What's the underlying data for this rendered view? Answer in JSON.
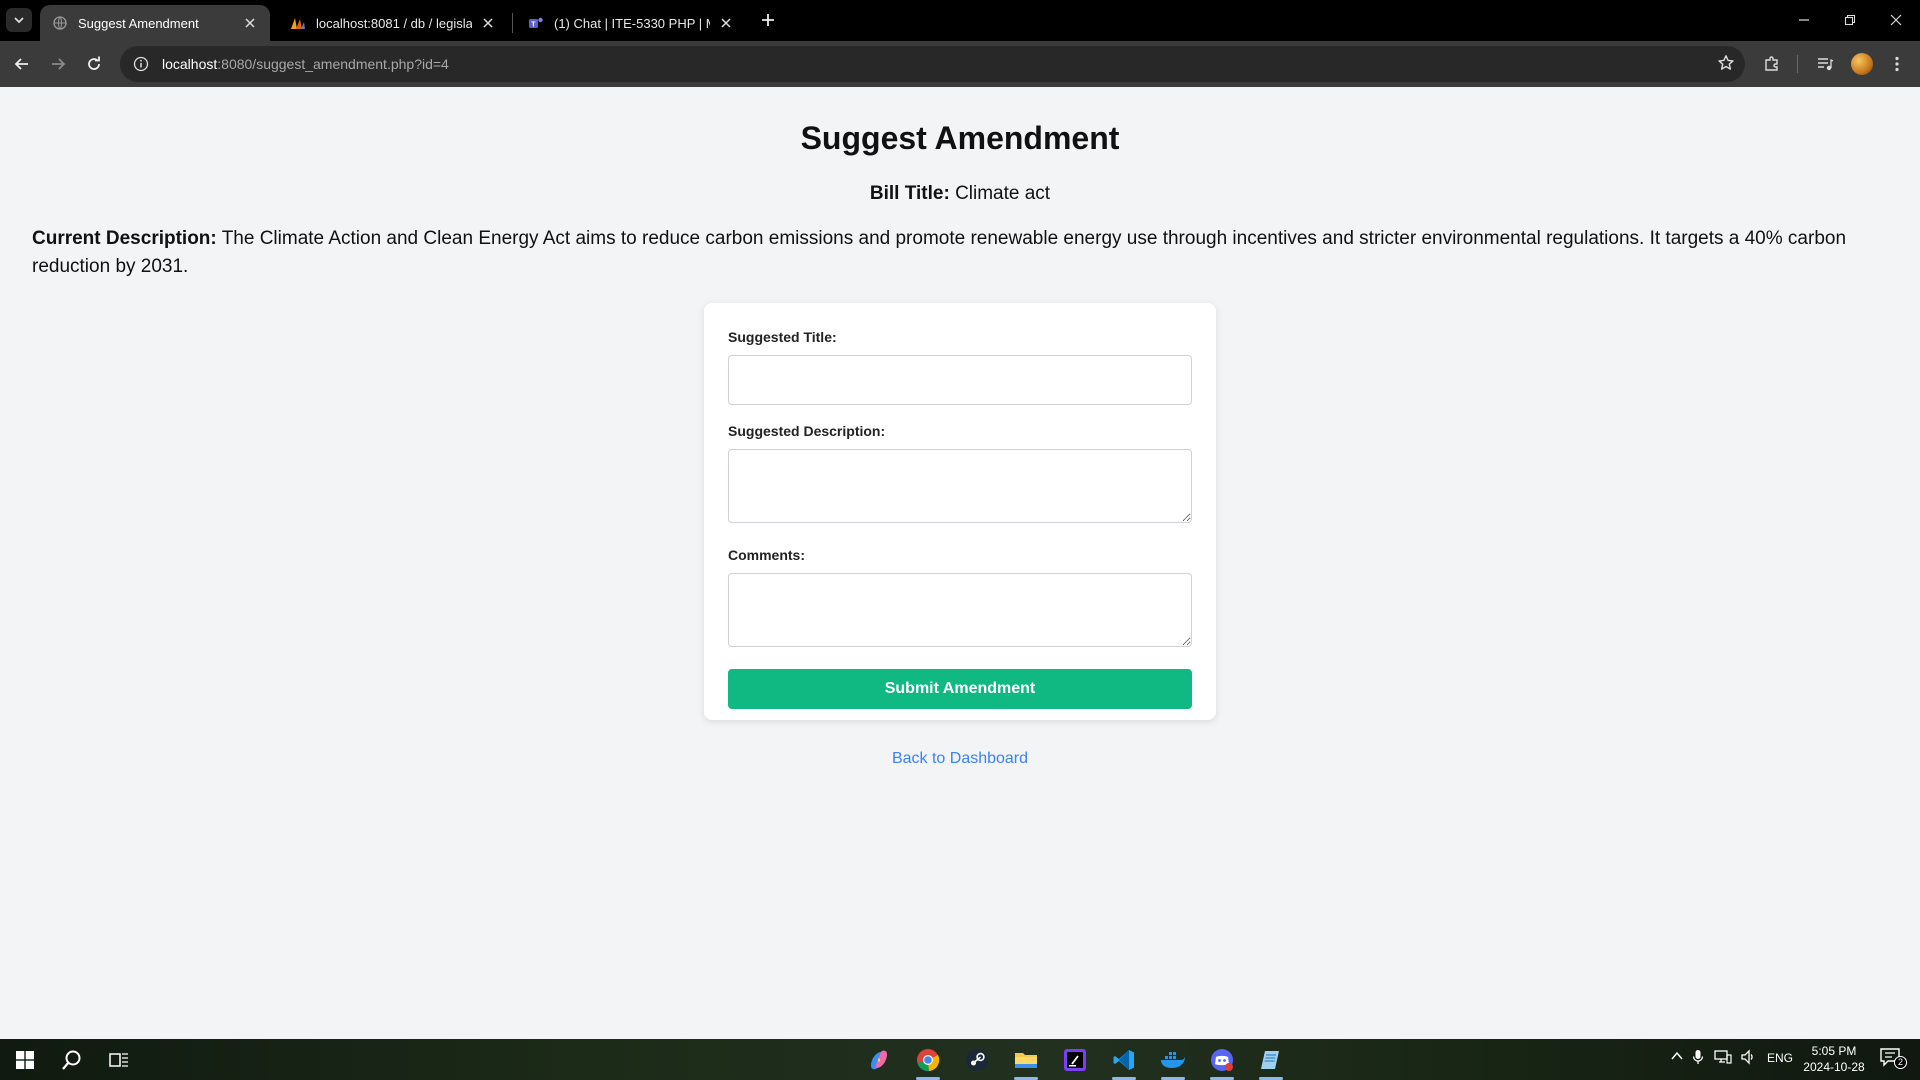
{
  "browser": {
    "tabs": [
      {
        "title": "Suggest Amendment",
        "active": true
      },
      {
        "title": "localhost:8081 / db / legislation",
        "active": false
      },
      {
        "title": "(1) Chat | ITE-5330 PHP | Micro",
        "active": false
      }
    ],
    "url_host": "localhost",
    "url_rest": ":8080/suggest_amendment.php?id=4"
  },
  "page": {
    "title": "Suggest Amendment",
    "bill_title_label": "Bill Title:",
    "bill_title_value": "Climate act",
    "current_description_label": "Current Description:",
    "current_description_value": "The Climate Action and Clean Energy Act aims to reduce carbon emissions and promote renewable energy use through incentives and stricter environmental regulations. It targets a 40% carbon reduction by 2031.",
    "form": {
      "suggested_title_label": "Suggested Title:",
      "suggested_title_value": "",
      "suggested_description_label": "Suggested Description:",
      "suggested_description_value": "",
      "comments_label": "Comments:",
      "comments_value": "",
      "submit_label": "Submit Amendment"
    },
    "back_link": "Back to Dashboard"
  },
  "taskbar": {
    "language": "ENG",
    "time": "5:05 PM",
    "date": "2024-10-28",
    "notification_count": "2"
  },
  "colors": {
    "accent_green": "#10b981",
    "link_blue": "#3b82f6",
    "page_bg": "#f3f4f6"
  }
}
